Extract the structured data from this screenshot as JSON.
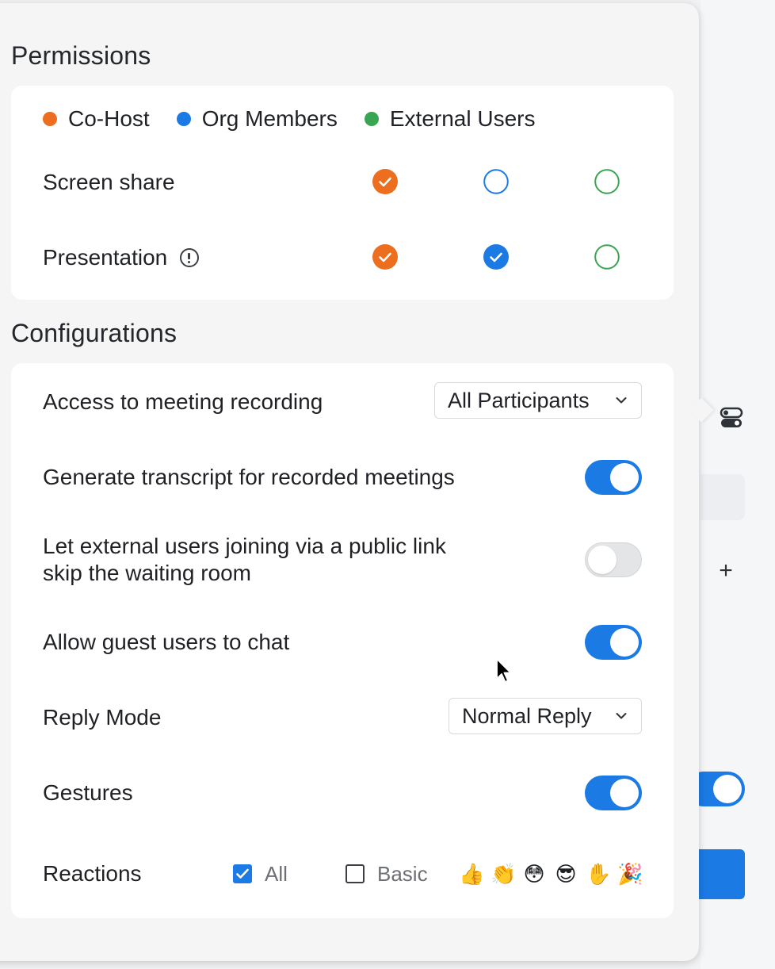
{
  "permissions": {
    "title": "Permissions",
    "legend": [
      {
        "label": "Co-Host",
        "color": "#ec6e1e"
      },
      {
        "label": "Org Members",
        "color": "#1b7ae3"
      },
      {
        "label": "External Users",
        "color": "#3aa551"
      }
    ],
    "rows": [
      {
        "label": "Screen share",
        "cohost": true,
        "org_members": false,
        "external_users": false,
        "info": false
      },
      {
        "label": "Presentation",
        "cohost": true,
        "org_members": true,
        "external_users": false,
        "info": true
      }
    ]
  },
  "configurations": {
    "title": "Configurations",
    "recording_access": {
      "label": "Access to meeting recording",
      "value": "All Participants"
    },
    "transcript": {
      "label": "Generate transcript for recorded meetings",
      "on": true
    },
    "skip_waiting_room": {
      "label_line1": "Let external users joining via a public link",
      "label_line2": "skip the waiting room",
      "on": false
    },
    "guest_chat": {
      "label": "Allow guest users to chat",
      "on": true
    },
    "reply_mode": {
      "label": "Reply Mode",
      "value": "Normal Reply"
    },
    "gestures": {
      "label": "Gestures",
      "on": true
    },
    "reactions": {
      "label": "Reactions",
      "all_label": "All",
      "all_checked": true,
      "basic_label": "Basic",
      "basic_checked": false,
      "emojis": [
        "👍",
        "👏",
        "😳",
        "😎",
        "✋",
        "🎉"
      ]
    }
  },
  "icons": {
    "side": "toggle-settings-icon",
    "plus": "plus-icon"
  },
  "colors": {
    "accent": "#1b7ae3",
    "cohost": "#ec6e1e",
    "external": "#3aa551"
  }
}
